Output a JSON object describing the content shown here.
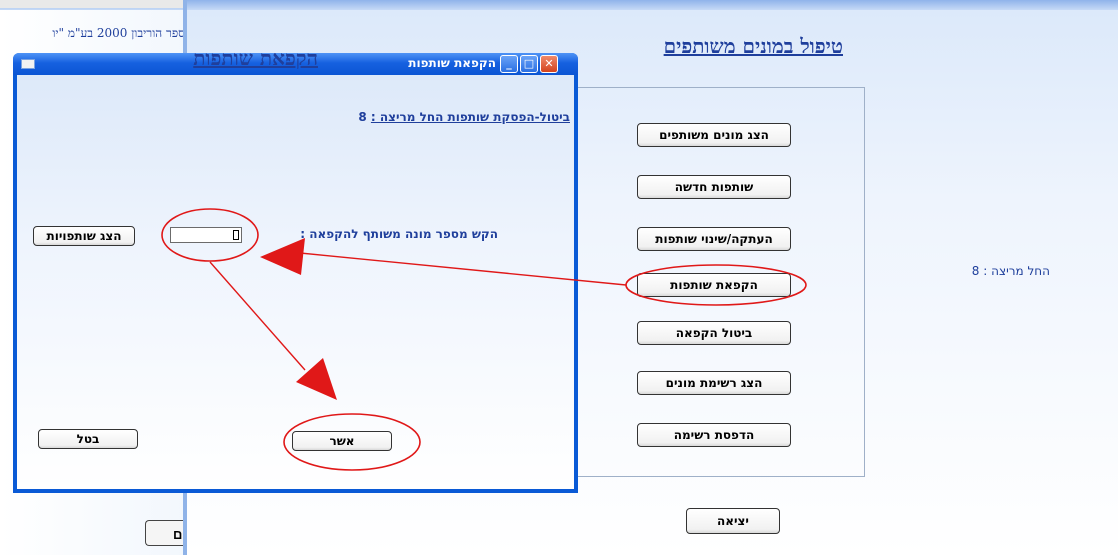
{
  "background_window": {
    "left_strip_text": "ספר הוריבון 2000 בע\"מ \"יו",
    "left_button_label": "ים"
  },
  "main": {
    "title": "טיפול במונים משותפים",
    "buttons": [
      "הצג מונים משותפים",
      "שותפות חדשה",
      "העתקה/שינוי שותפות",
      "הקפאת שותפות",
      "ביטול הקפאה",
      "הצג רשימת מונים",
      "הדפסת רשימה"
    ],
    "exit_label": "יציאה",
    "run_label": "החל מריצה : 8"
  },
  "dialog": {
    "title": "הקפאת שותפות",
    "heading": "הקפאת שותפות",
    "cancel_line_label": "ביטול-הפסקת שותפות החל מריצה :",
    "cancel_line_value": "8",
    "prompt": "הקש מספר מונה משותף להקפאה :",
    "input_value": "",
    "show_partnerships_label": "הצג שותפויות",
    "ok_label": "אשר",
    "cancel_label": "בטל"
  },
  "colors": {
    "titlebar": "#0b55d4",
    "accent_text": "#1f3f9c",
    "annotation": "#e01818"
  }
}
